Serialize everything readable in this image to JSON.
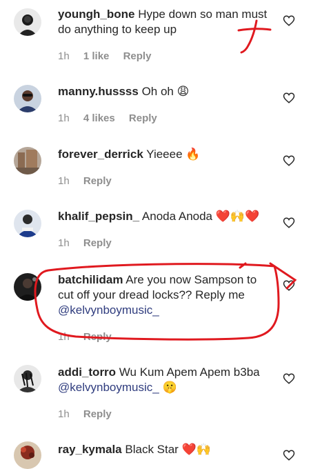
{
  "comments": [
    {
      "username": "youngh_bone",
      "text": "Hype down so man must do anything to keep up",
      "emoji": "",
      "mention": "",
      "time": "1h",
      "likes": "1 like",
      "reply": "Reply"
    },
    {
      "username": "manny.hussss",
      "text": "Oh oh",
      "emoji": "😩",
      "mention": "",
      "time": "1h",
      "likes": "4 likes",
      "reply": "Reply"
    },
    {
      "username": "forever_derrick",
      "text": "Yieeee",
      "emoji": "🔥",
      "mention": "",
      "time": "1h",
      "likes": "",
      "reply": "Reply"
    },
    {
      "username": "khalif_pepsin_",
      "text": "Anoda Anoda",
      "emoji": "❤️🙌❤️",
      "mention": "",
      "time": "1h",
      "likes": "",
      "reply": "Reply"
    },
    {
      "username": "batchilidam",
      "text": "Are you now Sampson to cut off your dread locks?? Reply me",
      "emoji": "",
      "mention": "@kelvynboymusic_",
      "time": "1h",
      "likes": "",
      "reply": "Reply"
    },
    {
      "username": "addi_torro",
      "text": "Wu Kum Apem Apem b3ba",
      "emoji": "🤫",
      "mention": "@kelvynboymusic_",
      "time": "1h",
      "likes": "",
      "reply": "Reply"
    },
    {
      "username": "ray_kymala",
      "text": "Black Star",
      "emoji": "❤️🙌",
      "mention": "",
      "time": "",
      "likes": "",
      "reply": ""
    }
  ],
  "icons": {
    "like": "heart-outline-icon"
  },
  "colors": {
    "annotation": "#e0191f",
    "mention": "#2f3c7e",
    "meta": "#8e8e8e"
  }
}
